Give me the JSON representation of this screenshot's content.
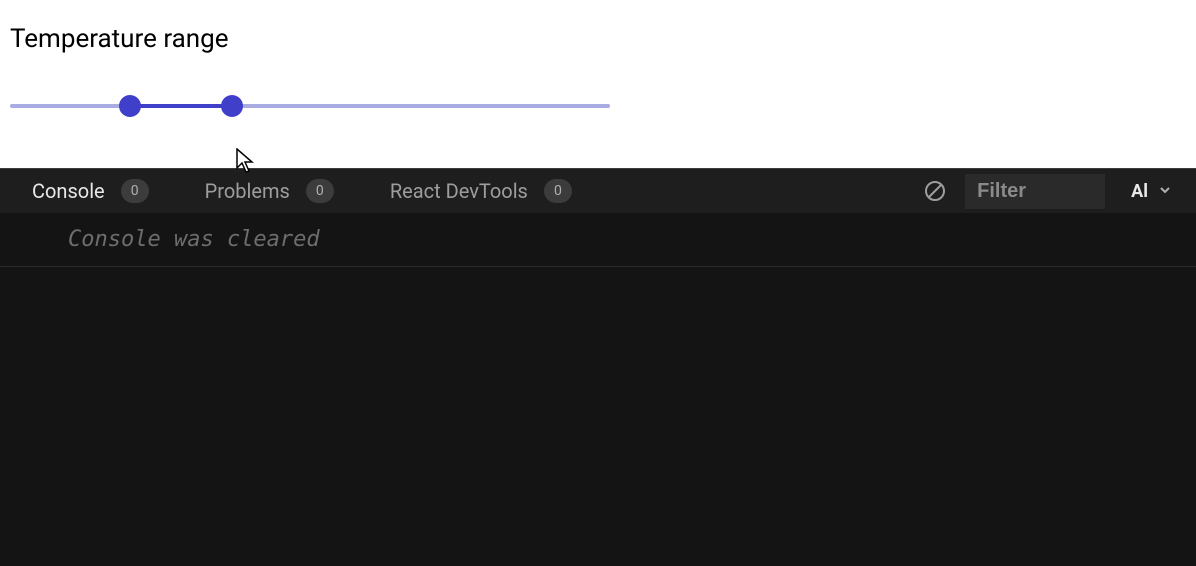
{
  "content": {
    "slider_label": "Temperature range",
    "slider": {
      "min": 0,
      "max": 100,
      "low": 20,
      "high": 37
    }
  },
  "devtools": {
    "tabs": [
      {
        "label": "Console",
        "badge": "0",
        "active": true
      },
      {
        "label": "Problems",
        "badge": "0",
        "active": false
      },
      {
        "label": "React DevTools",
        "badge": "0",
        "active": false
      }
    ],
    "filter_placeholder": "Filter",
    "level_label": "Al",
    "console_cleared": "Console was cleared"
  }
}
